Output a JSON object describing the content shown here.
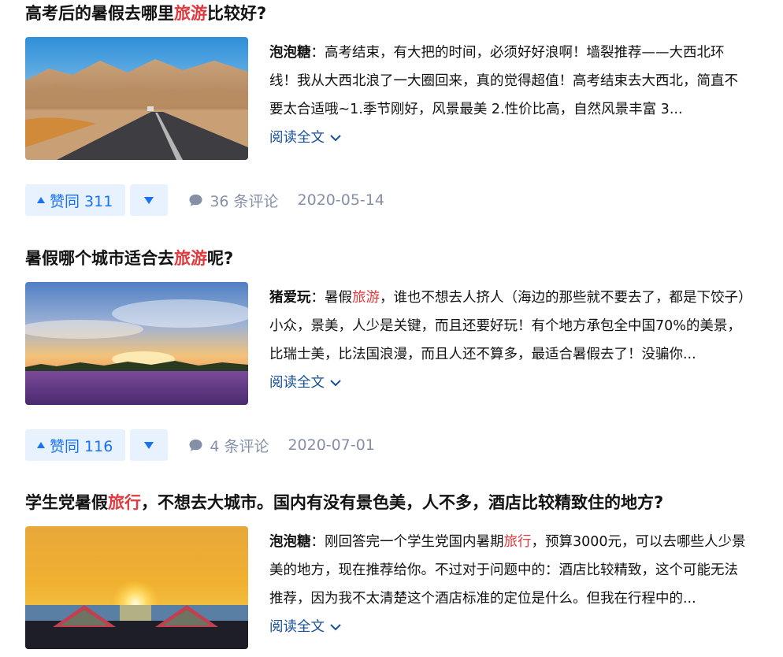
{
  "answers": [
    {
      "title_pre": "高考后的暑假去哪里",
      "title_hl": "旅游",
      "title_post": "比较好?",
      "author": "泡泡糖",
      "excerpt_pre": "：高考结束，有大把的时间，必须好好浪啊！墙裂推荐——大西北环线！我从大西北浪了一大圈回来，真的觉得超值！高考结束去大西北，简直不要太合适哦~1.季节刚好，风景最美 2.性价比高，自然风景丰富 3...",
      "excerpt_hl": "",
      "excerpt_post": "",
      "read_more": "阅读全文",
      "vote_label": "赞同 311",
      "comments": "36 条评论",
      "date": "2020-05-14"
    },
    {
      "title_pre": "暑假哪个城市适合去",
      "title_hl": "旅游",
      "title_post": "呢?",
      "author": "猪爱玩",
      "excerpt_pre": "：暑假",
      "excerpt_hl": "旅游",
      "excerpt_post": "，谁也不想去人挤人（海边的那些就不要去了，都是下饺子）小众，景美，人少是关键，而且还要好玩！有个地方承包全中国70%的美景，比瑞士美，比法国浪漫，而且人还不算多，最适合暑假去了！没骗你...",
      "read_more": "阅读全文",
      "vote_label": "赞同 116",
      "comments": "4 条评论",
      "date": "2020-07-01"
    },
    {
      "title_pre": "学生党暑假",
      "title_hl": "旅行",
      "title_post": "，不想去大城市。国内有没有景色美，人不多，酒店比较精致住的地方?",
      "author": "泡泡糖",
      "excerpt_pre": "：刚回答完一个学生党国内暑期",
      "excerpt_hl": "旅行",
      "excerpt_post": "，预算3000元，可以去哪些人少景美的地方，现在推荐给你。不过对于问题中的：酒店比较精致，这个可能无法推荐，因为我不太清楚这个酒店标准的定位是什么。但我在行程中的...",
      "read_more": "阅读全文",
      "vote_label": "",
      "comments": "",
      "date": ""
    }
  ],
  "colors": {
    "highlight": "#e0393e",
    "link": "#175199",
    "vote_bg": "#e8f1fe",
    "vote_fg": "#1772f6",
    "meta": "#8590a6"
  }
}
